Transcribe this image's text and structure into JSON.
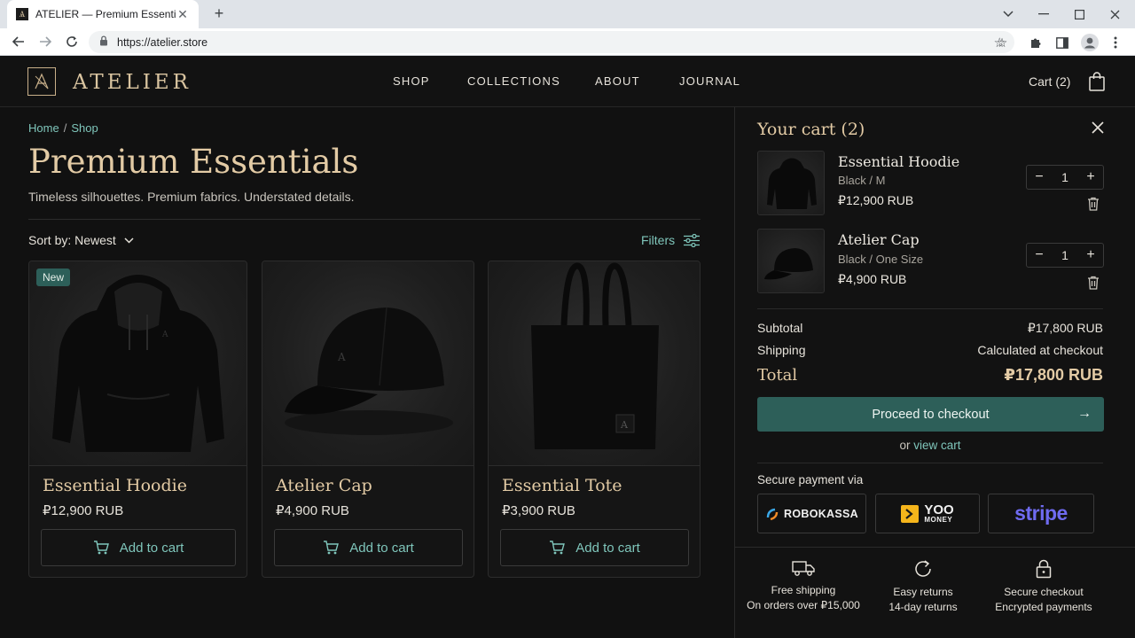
{
  "browser": {
    "tab_title": "ATELIER — Premium Essentials",
    "tab_favicon": "AX",
    "tab_close": "✕",
    "new_tab": "+",
    "url": "https://atelier.store"
  },
  "header": {
    "logo_mark": "A",
    "brand": "ATELIER",
    "nav": [
      "SHOP",
      "COLLECTIONS",
      "ABOUT",
      "JOURNAL"
    ],
    "cart_label": "Cart (2)"
  },
  "main": {
    "breadcrumb": [
      "Home",
      "Shop"
    ],
    "breadcrumb_sep": "/",
    "title": "Premium Essentials",
    "subtitle": "Timeless silhouettes. Premium fabrics. Understated details.",
    "sort_label": "Sort by: Newest",
    "filters_label": "Filters",
    "products": [
      {
        "name": "Essential Hoodie",
        "price": "₽12,900 RUB",
        "badge": "New",
        "button": "Add to cart"
      },
      {
        "name": "Atelier Cap",
        "price": "₽4,900 RUB",
        "button": "Add to cart"
      },
      {
        "name": "Essential Tote",
        "price": "₽3,900 RUB",
        "button": "Add to cart"
      }
    ]
  },
  "cart": {
    "title": "Your cart (2)",
    "items": [
      {
        "name": "Essential Hoodie",
        "variant": "Black / M",
        "price": "₽12,900 RUB",
        "qty": "1"
      },
      {
        "name": "Atelier Cap",
        "variant": "Black / One Size",
        "price": "₽4,900 RUB",
        "qty": "1"
      }
    ],
    "minus": "−",
    "plus": "+",
    "subtotal_label": "Subtotal",
    "subtotal_value": "₽17,800 RUB",
    "shipping_label": "Shipping",
    "shipping_value": "Calculated at checkout",
    "total_label": "Total",
    "total_value": "₽17,800 RUB",
    "checkout_label": "Proceed to checkout",
    "checkout_arrow": "→",
    "view_cart_prefix": "or",
    "view_cart_link": "view cart",
    "secure_label": "Secure payment via",
    "payments": {
      "robokassa": "ROBOKASSA",
      "yoo_top": "YOO",
      "yoo_bottom": "MONEY",
      "stripe": "stripe"
    },
    "benefits": [
      {
        "title": "Free shipping",
        "sub": "On orders over ₽15,000",
        "icon": "truck-icon"
      },
      {
        "title": "Easy returns",
        "sub": "14-day returns",
        "icon": "refresh-icon"
      },
      {
        "title": "Secure checkout",
        "sub": "Encrypted payments",
        "icon": "lock-icon"
      }
    ]
  },
  "colors": {
    "accent_teal": "#2d5f59",
    "link_teal": "#7fc6bb",
    "gold": "#e3cba5",
    "background": "#111111"
  }
}
